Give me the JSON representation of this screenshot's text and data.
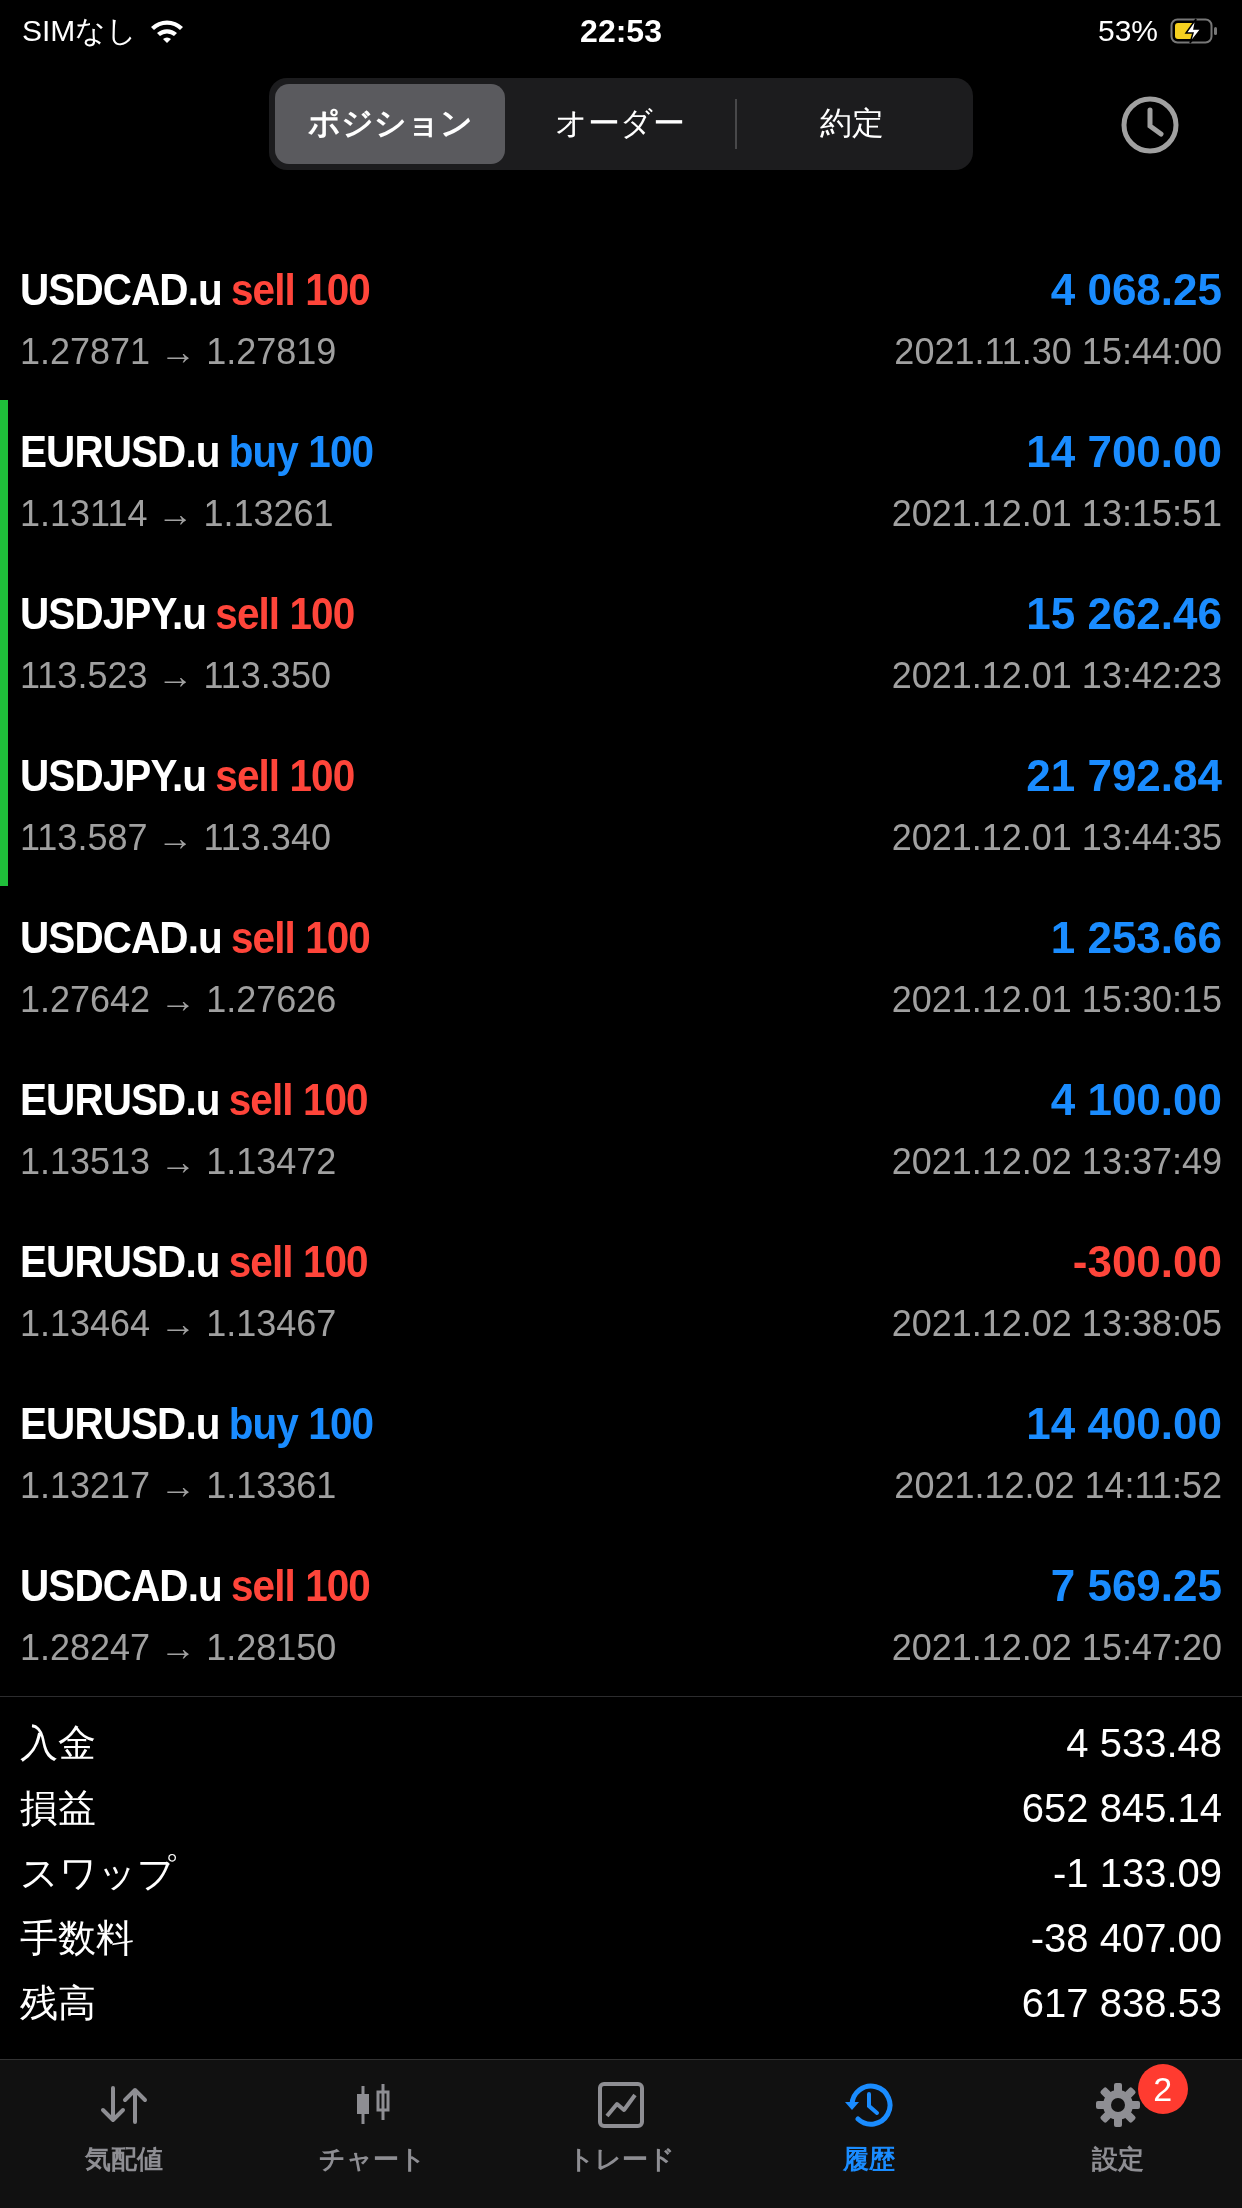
{
  "status_bar": {
    "carrier": "SIMなし",
    "time": "22:53",
    "battery": "53%"
  },
  "segments": [
    {
      "label": "ポジション",
      "selected": true
    },
    {
      "label": "オーダー",
      "selected": false
    },
    {
      "label": "約定",
      "selected": false
    }
  ],
  "deals": [
    {
      "symbol": "USDCAD.u",
      "side": {
        "text": "sell 100",
        "color": "#ff453a"
      },
      "profit": {
        "text": "4 068.25",
        "color": "#1a8cff"
      },
      "prices": "1.27871 → 1.27819",
      "time": "2021.11.30 15:44:00",
      "marked": false
    },
    {
      "symbol": "EURUSD.u",
      "side": {
        "text": "buy 100",
        "color": "#1a8cff"
      },
      "profit": {
        "text": "14 700.00",
        "color": "#1a8cff"
      },
      "prices": "1.13114 → 1.13261",
      "time": "2021.12.01 13:15:51",
      "marked": true
    },
    {
      "symbol": "USDJPY.u",
      "side": {
        "text": "sell 100",
        "color": "#ff453a"
      },
      "profit": {
        "text": "15 262.46",
        "color": "#1a8cff"
      },
      "prices": "113.523 → 113.350",
      "time": "2021.12.01 13:42:23",
      "marked": true
    },
    {
      "symbol": "USDJPY.u",
      "side": {
        "text": "sell 100",
        "color": "#ff453a"
      },
      "profit": {
        "text": "21 792.84",
        "color": "#1a8cff"
      },
      "prices": "113.587 → 113.340",
      "time": "2021.12.01 13:44:35",
      "marked": true
    },
    {
      "symbol": "USDCAD.u",
      "side": {
        "text": "sell 100",
        "color": "#ff453a"
      },
      "profit": {
        "text": "1 253.66",
        "color": "#1a8cff"
      },
      "prices": "1.27642 → 1.27626",
      "time": "2021.12.01 15:30:15",
      "marked": false
    },
    {
      "symbol": "EURUSD.u",
      "side": {
        "text": "sell 100",
        "color": "#ff453a"
      },
      "profit": {
        "text": "4 100.00",
        "color": "#1a8cff"
      },
      "prices": "1.13513 → 1.13472",
      "time": "2021.12.02 13:37:49",
      "marked": false
    },
    {
      "symbol": "EURUSD.u",
      "side": {
        "text": "sell 100",
        "color": "#ff453a"
      },
      "profit": {
        "text": "-300.00",
        "color": "#ff453a"
      },
      "prices": "1.13464 → 1.13467",
      "time": "2021.12.02 13:38:05",
      "marked": false
    },
    {
      "symbol": "EURUSD.u",
      "side": {
        "text": "buy 100",
        "color": "#1a8cff"
      },
      "profit": {
        "text": "14 400.00",
        "color": "#1a8cff"
      },
      "prices": "1.13217 → 1.13361",
      "time": "2021.12.02 14:11:52",
      "marked": false
    },
    {
      "symbol": "USDCAD.u",
      "side": {
        "text": "sell 100",
        "color": "#ff453a"
      },
      "profit": {
        "text": "7 569.25",
        "color": "#1a8cff"
      },
      "prices": "1.28247 → 1.28150",
      "time": "2021.12.02 15:47:20",
      "marked": false
    }
  ],
  "summary": [
    {
      "label": "入金",
      "value": "4 533.48"
    },
    {
      "label": "損益",
      "value": "652 845.14"
    },
    {
      "label": "スワップ",
      "value": "-1 133.09"
    },
    {
      "label": "手数料",
      "value": "-38 407.00"
    },
    {
      "label": "残高",
      "value": "617 838.53"
    }
  ],
  "tabs": [
    {
      "kind": "quotes",
      "label": "気配値",
      "selected": false
    },
    {
      "kind": "chart",
      "label": "チャート",
      "selected": false
    },
    {
      "kind": "trade",
      "label": "トレード",
      "selected": false
    },
    {
      "kind": "history",
      "label": "履歴",
      "selected": true
    },
    {
      "kind": "settings",
      "label": "設定",
      "selected": false,
      "badge": "2"
    }
  ]
}
